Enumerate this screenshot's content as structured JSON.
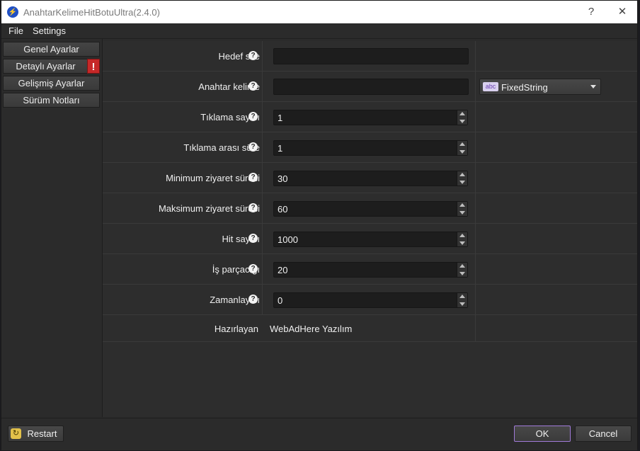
{
  "window": {
    "title": "AnahtarKelimeHitBotuUltra(2.4.0)",
    "help_btn": "?",
    "close_btn": "✕",
    "app_icon": "bolt-icon"
  },
  "menu": {
    "items": [
      "File",
      "Settings"
    ]
  },
  "sidebar": {
    "items": [
      {
        "label": "Genel Ayarlar"
      },
      {
        "label": "Detaylı Ayarlar",
        "warning": "!"
      },
      {
        "label": "Gelişmiş Ayarlar"
      },
      {
        "label": "Sürüm Notları"
      }
    ]
  },
  "form": {
    "help_glyph": "?",
    "hedef_site": {
      "label": "Hedef site",
      "value": ""
    },
    "anahtar_kelime": {
      "label": "Anahtar kelime",
      "value": "",
      "mode_icon": "abc",
      "mode": "FixedString"
    },
    "tiklama_sayisi": {
      "label": "Tıklama sayısı",
      "value": "1"
    },
    "tiklama_arasi": {
      "label": "Tıklama arası süre",
      "value": "1"
    },
    "min_ziyaret": {
      "label": "Minimum ziyaret süresi",
      "value": "30"
    },
    "max_ziyaret": {
      "label": "Maksimum ziyaret süresi",
      "value": "60"
    },
    "hit_sayisi": {
      "label": "Hit sayısı",
      "value": "1000"
    },
    "is_parcacigi": {
      "label": "İş parçacığı",
      "value": "20"
    },
    "zamanlayici": {
      "label": "Zamanlayıcı",
      "value": "0"
    },
    "hazirlayan": {
      "label": "Hazırlayan",
      "value": "WebAdHere Yazılım"
    }
  },
  "footer": {
    "restart_label": "Restart",
    "restart_icon": "↻",
    "ok_label": "OK",
    "cancel_label": "Cancel"
  },
  "colors": {
    "accent_ok_border": "#a07ad8",
    "warning": "#c62828"
  }
}
